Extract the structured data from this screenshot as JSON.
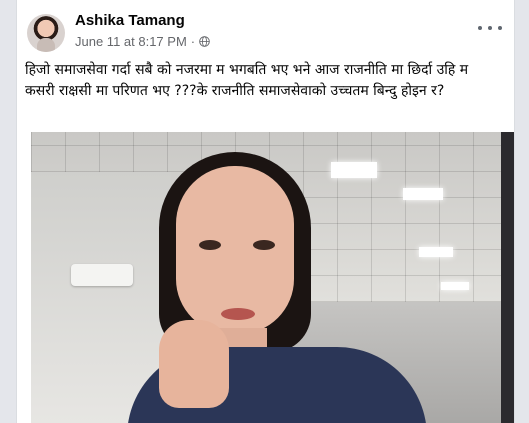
{
  "post": {
    "author": "Ashika Tamang",
    "date": "June 11 at 8:17 PM",
    "separator": "·",
    "text": "हिजो समाजसेवा गर्दा सबै को नजरमा म भगबति भए भने आज राजनीति मा छिर्दा उहि म कसरी राक्षसी मा परिणत भए ???के राजनीति समाजसेवाको उच्चतम बिन्दु होइन र?"
  },
  "icons": {
    "avatar": "profile-photo",
    "privacy": "globe-icon",
    "more": "more-options-icon"
  },
  "colors": {
    "text": "#050505",
    "meta": "#65676b",
    "background": "#e4e6eb"
  }
}
